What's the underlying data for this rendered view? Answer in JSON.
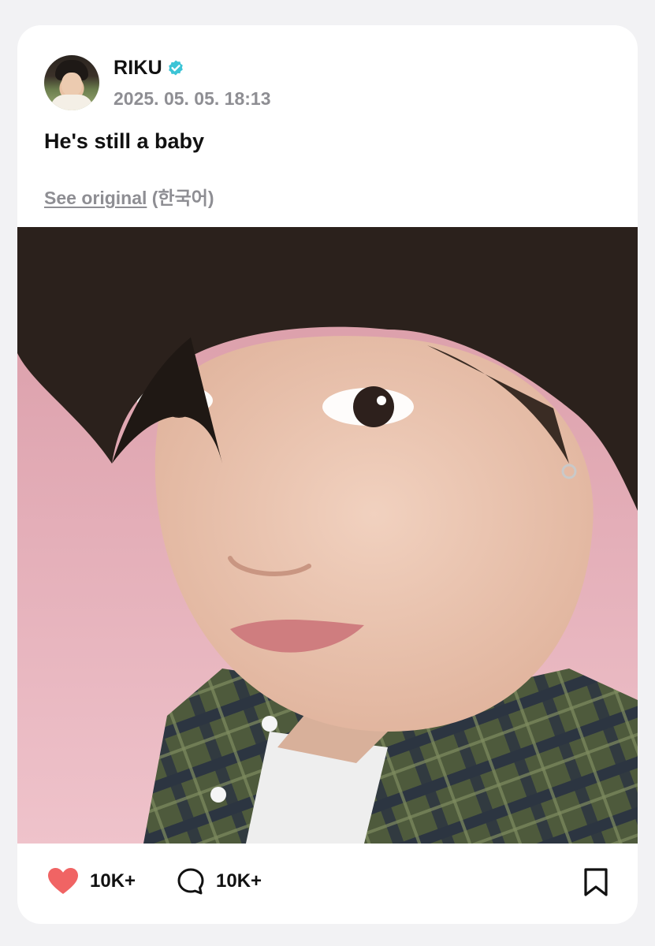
{
  "post": {
    "author": "RIKU",
    "timestamp": "2025. 05. 05. 18:13",
    "text": "He's still a baby",
    "translation_link": "See original",
    "translation_lang": "(한국어)",
    "likes": "10K+",
    "comments": "10K+"
  },
  "icons": {
    "verified": "verified-check-icon",
    "like": "heart-icon",
    "comment": "speech-bubble-icon",
    "bookmark": "bookmark-icon"
  },
  "colors": {
    "verified": "#3cc4d6",
    "heart": "#f06464",
    "muted_text": "#8e8e93",
    "photo_background": "#e8b7bf"
  }
}
